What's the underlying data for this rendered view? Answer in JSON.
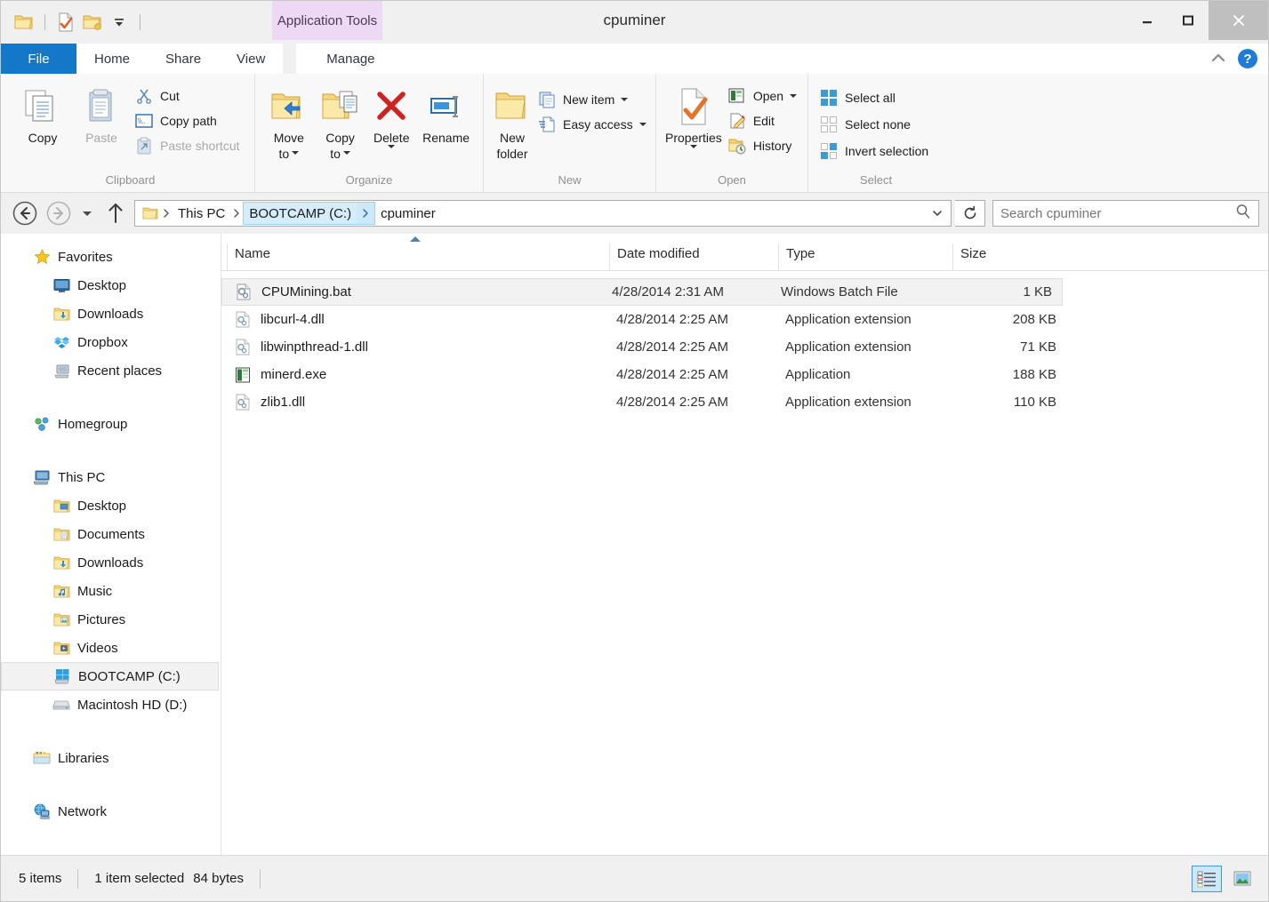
{
  "window": {
    "title": "cpuminer",
    "contextual_tab_group": "Application Tools",
    "controls": {
      "minimize": "minimize-icon",
      "maximize": "maximize-icon",
      "close": "close-icon"
    }
  },
  "quick_access": {
    "items": [
      {
        "name": "folder-icon",
        "label": "Folder"
      },
      {
        "name": "properties-icon",
        "label": "Properties"
      },
      {
        "name": "new-folder-icon",
        "label": "New folder"
      },
      {
        "name": "customize-caret-icon",
        "label": "Customize Quick Access Toolbar"
      }
    ]
  },
  "tabs": [
    {
      "id": "file",
      "label": "File"
    },
    {
      "id": "home",
      "label": "Home"
    },
    {
      "id": "share",
      "label": "Share"
    },
    {
      "id": "view",
      "label": "View"
    },
    {
      "id": "manage",
      "label": "Manage"
    }
  ],
  "ribbon": {
    "collapse_icon": "chevron-up-icon",
    "help_icon": "help-icon",
    "help_label": "?",
    "groups": [
      {
        "label": "Clipboard",
        "big_buttons": [
          {
            "label": "Copy",
            "icon": "copy-icon",
            "disabled": false
          },
          {
            "label": "Paste",
            "icon": "paste-icon",
            "disabled": true
          }
        ],
        "small_buttons": [
          {
            "label": "Cut",
            "icon": "cut-icon",
            "disabled": false
          },
          {
            "label": "Copy path",
            "icon": "copy-path-icon",
            "disabled": false
          },
          {
            "label": "Paste shortcut",
            "icon": "paste-shortcut-icon",
            "disabled": true
          }
        ]
      },
      {
        "label": "Organize",
        "big_buttons": [
          {
            "label": "Move",
            "label2": "to",
            "icon": "move-to-icon",
            "dropdown": true
          },
          {
            "label": "Copy",
            "label2": "to",
            "icon": "copy-to-icon",
            "dropdown": true
          },
          {
            "label": "Delete",
            "icon": "delete-icon",
            "dropdown": true
          },
          {
            "label": "Rename",
            "icon": "rename-icon",
            "dropdown": false
          }
        ]
      },
      {
        "label": "New",
        "big_buttons": [
          {
            "label": "New",
            "label2": "folder",
            "icon": "new-folder-icon"
          }
        ],
        "small_buttons": [
          {
            "label": "New item",
            "icon": "new-item-icon",
            "dropdown": true
          },
          {
            "label": "Easy access",
            "icon": "easy-access-icon",
            "dropdown": true
          }
        ]
      },
      {
        "label": "Open",
        "big_buttons": [
          {
            "label": "Properties",
            "icon": "properties-icon",
            "dropdown": true
          }
        ],
        "small_buttons": [
          {
            "label": "Open",
            "icon": "open-icon",
            "dropdown": true
          },
          {
            "label": "Edit",
            "icon": "edit-icon"
          },
          {
            "label": "History",
            "icon": "history-icon"
          }
        ]
      },
      {
        "label": "Select",
        "small_buttons": [
          {
            "label": "Select all",
            "icon": "select-all-icon"
          },
          {
            "label": "Select none",
            "icon": "select-none-icon"
          },
          {
            "label": "Invert selection",
            "icon": "invert-selection-icon"
          }
        ]
      }
    ]
  },
  "address_bar": {
    "back_icon": "back-arrow-icon",
    "forward_icon": "forward-arrow-icon",
    "recent_icon": "recent-locations-caret-icon",
    "up_icon": "up-arrow-icon",
    "folder_icon": "folder-icon",
    "dropdown_icon": "chevron-down-icon",
    "refresh_icon": "refresh-icon",
    "breadcrumbs": [
      {
        "label": "This PC",
        "selected": false
      },
      {
        "label": "BOOTCAMP (C:)",
        "selected": true
      },
      {
        "label": "cpuminer",
        "selected": false
      }
    ]
  },
  "search": {
    "placeholder": "Search cpuminer",
    "value": "",
    "icon": "search-icon"
  },
  "nav_pane": {
    "sections": [
      {
        "root": {
          "label": "Favorites",
          "icon": "star-icon"
        },
        "children": [
          {
            "label": "Desktop",
            "icon": "desktop-icon"
          },
          {
            "label": "Downloads",
            "icon": "downloads-folder-icon"
          },
          {
            "label": "Dropbox",
            "icon": "dropbox-icon"
          },
          {
            "label": "Recent places",
            "icon": "recent-places-icon"
          }
        ]
      },
      {
        "root": {
          "label": "Homegroup",
          "icon": "homegroup-icon"
        },
        "children": []
      },
      {
        "root": {
          "label": "This PC",
          "icon": "this-pc-icon"
        },
        "children": [
          {
            "label": "Desktop",
            "icon": "desktop-folder-icon"
          },
          {
            "label": "Documents",
            "icon": "documents-folder-icon"
          },
          {
            "label": "Downloads",
            "icon": "downloads-folder-icon"
          },
          {
            "label": "Music",
            "icon": "music-folder-icon"
          },
          {
            "label": "Pictures",
            "icon": "pictures-folder-icon"
          },
          {
            "label": "Videos",
            "icon": "videos-folder-icon"
          },
          {
            "label": "BOOTCAMP (C:)",
            "icon": "windows-drive-icon",
            "selected": true
          },
          {
            "label": "Macintosh HD (D:)",
            "icon": "drive-icon"
          }
        ]
      },
      {
        "root": {
          "label": "Libraries",
          "icon": "libraries-icon"
        },
        "children": []
      },
      {
        "root": {
          "label": "Network",
          "icon": "network-icon"
        },
        "children": []
      }
    ]
  },
  "file_list": {
    "columns": [
      {
        "key": "name",
        "label": "Name",
        "sorted": "asc"
      },
      {
        "key": "date",
        "label": "Date modified"
      },
      {
        "key": "type",
        "label": "Type"
      },
      {
        "key": "size",
        "label": "Size"
      }
    ],
    "rows": [
      {
        "name": "CPUMining.bat",
        "date": "4/28/2014 2:31 AM",
        "type": "Windows Batch File",
        "size": "1 KB",
        "icon": "batch-file-icon",
        "selected": true
      },
      {
        "name": "libcurl-4.dll",
        "date": "4/28/2014 2:25 AM",
        "type": "Application extension",
        "size": "208 KB",
        "icon": "dll-file-icon",
        "selected": false
      },
      {
        "name": "libwinpthread-1.dll",
        "date": "4/28/2014 2:25 AM",
        "type": "Application extension",
        "size": "71 KB",
        "icon": "dll-file-icon",
        "selected": false
      },
      {
        "name": "minerd.exe",
        "date": "4/28/2014 2:25 AM",
        "type": "Application",
        "size": "188 KB",
        "icon": "exe-file-icon",
        "selected": false
      },
      {
        "name": "zlib1.dll",
        "date": "4/28/2014 2:25 AM",
        "type": "Application extension",
        "size": "110 KB",
        "icon": "dll-file-icon",
        "selected": false
      }
    ]
  },
  "status_bar": {
    "item_count": "5 items",
    "selection_info": "1 item selected",
    "selection_size": "84 bytes",
    "views": [
      {
        "name": "details-view",
        "label": "Details view",
        "active": true
      },
      {
        "name": "large-icons-view",
        "label": "Large icons view",
        "active": false
      }
    ]
  },
  "colors": {
    "accent": "#1477c8",
    "contextual_tab": "#eed9f5",
    "selection": "#f2f2f2",
    "crumb_selected": "#d5ecfb"
  }
}
